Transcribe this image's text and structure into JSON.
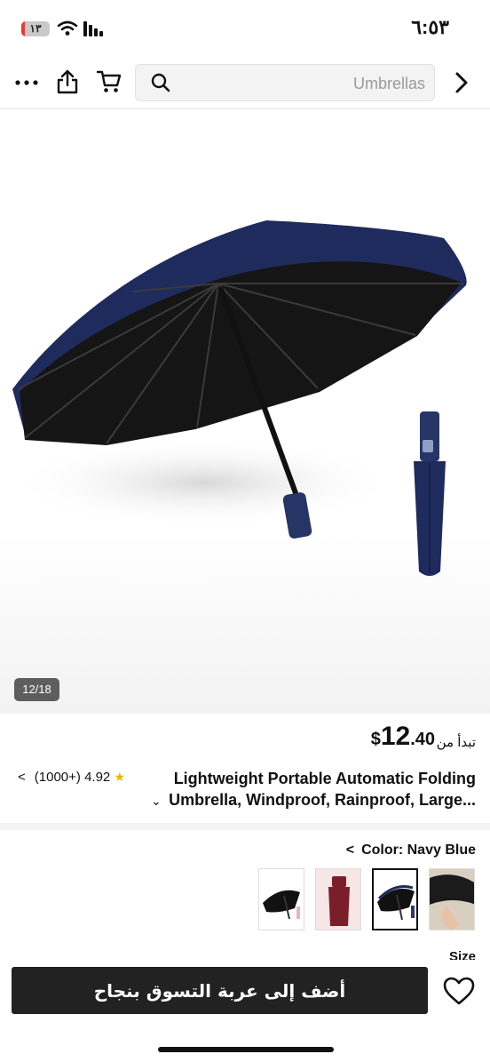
{
  "status_bar": {
    "time": "٦:٥٣",
    "battery_level": "١٣",
    "battery_fraction": 0.13
  },
  "nav": {
    "search_text": "Umbrellas"
  },
  "gallery": {
    "counter": "12/18"
  },
  "product": {
    "price_prefix": "تبدأ من",
    "currency": "$",
    "price_whole": "12",
    "price_cents": ".40",
    "title_line1": "Lightweight Portable Automatic Folding",
    "title_line2": "Umbrella, Windproof, Rainproof, Large...",
    "rating_value": "4.92",
    "rating_count": "(1000+)"
  },
  "color": {
    "label": "Color:",
    "value": "Navy Blue"
  },
  "size": {
    "label": "Size"
  },
  "actions": {
    "add_to_cart": "أضف إلى عربة التسوق بنجاح"
  },
  "colors": {
    "umbrella_navy": "#1f2b5c",
    "umbrella_black": "#151515",
    "cart_button": "#222222",
    "star": "#f0b400"
  }
}
